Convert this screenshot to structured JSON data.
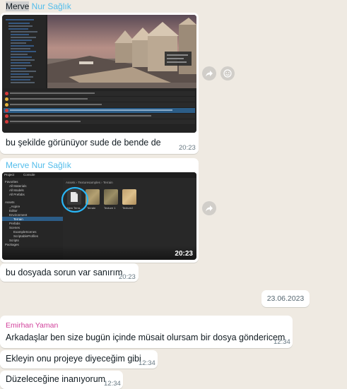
{
  "messages": [
    {
      "sender": "Merve Nur Sağlık",
      "text": "bu şekilde görünüyor sude de bende de",
      "time": "20:23"
    },
    {
      "sender": "Merve Nur Sağlık",
      "image_time": "20:23",
      "project_tab": "Project",
      "console_tab": "Console",
      "breadcrumb": "Assets › Texturesamples › Terrain",
      "tree": [
        "Favorites",
        "All Materials",
        "All Models",
        "All Prefabs",
        "Assets",
        "_Aspire",
        "Editor",
        "Environment",
        "Terrain",
        "Prefabs",
        "Scenes",
        "ExampleScenes",
        "ScriptableProfiles",
        "Scripts",
        "Packages"
      ],
      "tiles": [
        "New Terra...",
        "Terrain",
        "Texture 1",
        "Texture2"
      ],
      "text": "bu dosyada sorun var sanırım",
      "time": "20:23"
    },
    {
      "sender": "Emirhan Yaman",
      "text": "Arkadaşlar ben size bugün içinde müsait olursam bir dosya göndericem",
      "time": "12:34"
    },
    {
      "text": "Ekleyin onu projeye diyeceğim gibi",
      "time": "12:34"
    },
    {
      "text": "Düzeleceğine inanıyorum",
      "time": "12:34"
    }
  ],
  "date_separator": "23.06.2023",
  "colors": {
    "background": "#efeae2",
    "sender_merve": "#53bdeb",
    "sender_emirhan": "#d1409b",
    "timestamp": "#667781",
    "highlight_circle": "#29b6f6"
  }
}
